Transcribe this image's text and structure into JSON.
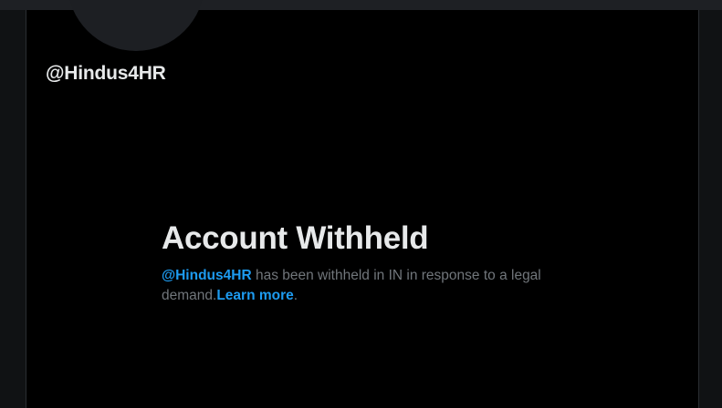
{
  "profile": {
    "handle": "@Hindus4HR"
  },
  "withheld_notice": {
    "title": "Account Withheld",
    "mention": "@Hindus4HR",
    "message_part_1": " has been withheld in IN in response to a legal demand.",
    "learn_more_label": "Learn more",
    "trailing": "."
  },
  "colors": {
    "background": "#000000",
    "primary_text": "#e7e9ea",
    "secondary_text": "#71767b",
    "accent": "#1d9bf0"
  }
}
